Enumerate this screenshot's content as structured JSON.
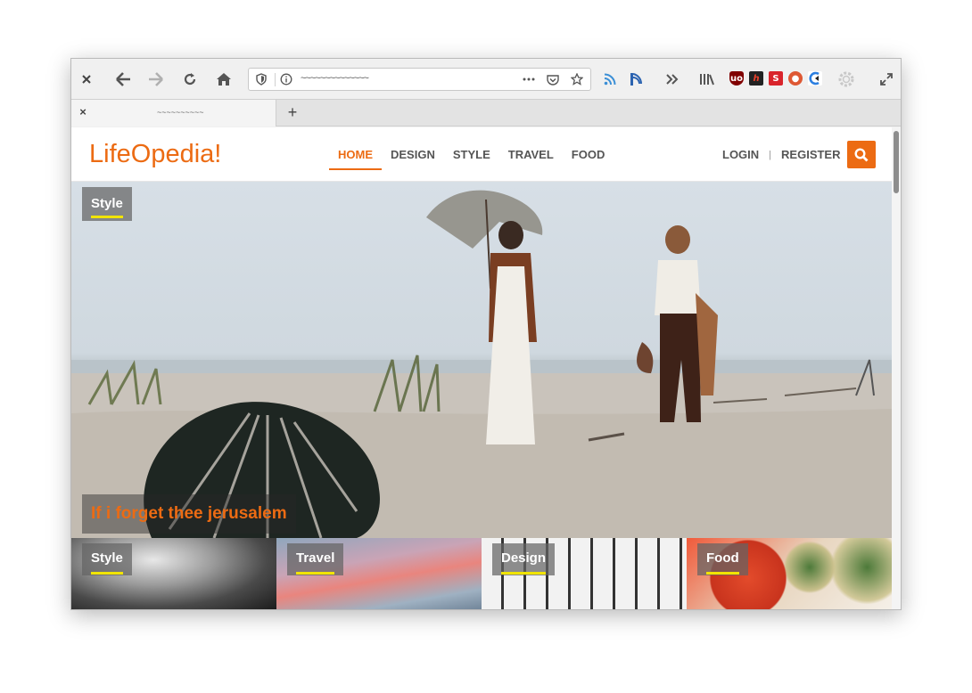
{
  "browser": {
    "url_text": "~~~~~~~~~~~~~~",
    "tab_title": "~~~~~~~~~~",
    "new_tab_label": "+",
    "icons": [
      "close-icon",
      "back-icon",
      "forward-icon",
      "reload-icon",
      "home-icon",
      "shield-icon",
      "info-icon",
      "more-icon",
      "pocket-icon",
      "star-icon",
      "rss-icon",
      "feed-icon",
      "overflow-icon",
      "library-icon",
      "ublock-icon",
      "honey-icon",
      "s-extension-icon",
      "duckduckgo-icon",
      "clearurls-icon",
      "gear-icon",
      "fullscreen-icon"
    ]
  },
  "site": {
    "logo": "LifeOpedia!",
    "accent_color": "#ec6b13",
    "nav": [
      {
        "label": "HOME",
        "active": true
      },
      {
        "label": "DESIGN",
        "active": false
      },
      {
        "label": "STYLE",
        "active": false
      },
      {
        "label": "TRAVEL",
        "active": false
      },
      {
        "label": "FOOD",
        "active": false
      }
    ],
    "login": "LOGIN",
    "separator": "|",
    "register": "REGISTER"
  },
  "hero": {
    "category": "Style",
    "title": "If i forget thee jerusalem"
  },
  "cards": [
    {
      "category": "Style"
    },
    {
      "category": "Travel"
    },
    {
      "category": "Design"
    },
    {
      "category": "Food"
    }
  ]
}
